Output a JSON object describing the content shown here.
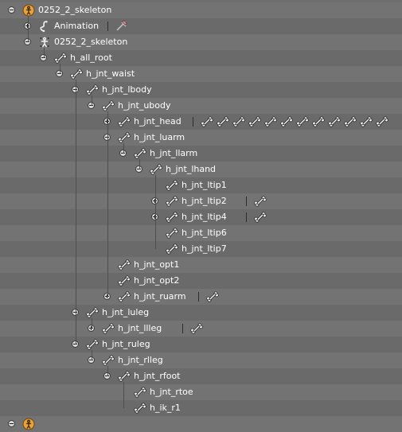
{
  "outliner": {
    "rows": [
      {
        "label": "0252_2_skeleton",
        "icon": "armature-object-icon",
        "expanded": true,
        "children_icons": []
      },
      {
        "label": "Animation",
        "icon": "animation-icon",
        "expanded": false,
        "children_icons": [
          "action-icon"
        ]
      },
      {
        "label": "0252_2_skeleton",
        "icon": "armature-data-icon",
        "expanded": true,
        "children_icons": []
      },
      {
        "label": "h_all_root",
        "icon": "bone-icon",
        "expanded": true,
        "children_icons": []
      },
      {
        "label": "h_jnt_waist",
        "icon": "bone-icon",
        "expanded": true,
        "children_icons": []
      },
      {
        "label": "h_jnt_lbody",
        "icon": "bone-icon",
        "expanded": true,
        "children_icons": []
      },
      {
        "label": "h_jnt_ubody",
        "icon": "bone-icon",
        "expanded": true,
        "children_icons": []
      },
      {
        "label": "h_jnt_head",
        "icon": "bone-icon",
        "expanded": false,
        "children_icons": [
          "bone-icon",
          "bone-icon",
          "bone-icon",
          "bone-icon",
          "bone-icon",
          "bone-icon",
          "bone-icon",
          "bone-icon",
          "bone-icon",
          "bone-icon",
          "bone-icon",
          "bone-icon"
        ]
      },
      {
        "label": "h_jnt_luarm",
        "icon": "bone-icon",
        "expanded": true,
        "children_icons": []
      },
      {
        "label": "h_jnt_llarm",
        "icon": "bone-icon",
        "expanded": true,
        "children_icons": []
      },
      {
        "label": "h_jnt_lhand",
        "icon": "bone-icon",
        "expanded": true,
        "children_icons": []
      },
      {
        "label": "h_jnt_ltip1",
        "icon": "bone-icon",
        "expanded": null,
        "children_icons": []
      },
      {
        "label": "h_jnt_ltip2",
        "icon": "bone-icon",
        "expanded": false,
        "children_icons": [
          "bone-icon"
        ]
      },
      {
        "label": "h_jnt_ltip4",
        "icon": "bone-icon",
        "expanded": false,
        "children_icons": [
          "bone-icon"
        ]
      },
      {
        "label": "h_jnt_ltip6",
        "icon": "bone-icon",
        "expanded": null,
        "children_icons": []
      },
      {
        "label": "h_jnt_ltip7",
        "icon": "bone-icon",
        "expanded": null,
        "children_icons": []
      },
      {
        "label": "h_jnt_opt1",
        "icon": "bone-icon",
        "expanded": null,
        "children_icons": []
      },
      {
        "label": "h_jnt_opt2",
        "icon": "bone-icon",
        "expanded": null,
        "children_icons": []
      },
      {
        "label": "h_jnt_ruarm",
        "icon": "bone-icon",
        "expanded": false,
        "children_icons": [
          "bone-icon"
        ]
      },
      {
        "label": "h_jnt_luleg",
        "icon": "bone-icon",
        "expanded": true,
        "children_icons": []
      },
      {
        "label": "h_jnt_llleg",
        "icon": "bone-icon",
        "expanded": false,
        "children_icons": [
          "bone-icon"
        ]
      },
      {
        "label": "h_jnt_ruleg",
        "icon": "bone-icon",
        "expanded": true,
        "children_icons": []
      },
      {
        "label": "h_jnt_rlleg",
        "icon": "bone-icon",
        "expanded": true,
        "children_icons": []
      },
      {
        "label": "h_jnt_rfoot",
        "icon": "bone-icon",
        "expanded": true,
        "children_icons": []
      },
      {
        "label": "h_jnt_rtoe",
        "icon": "bone-icon",
        "expanded": null,
        "children_icons": []
      },
      {
        "label": "h_ik_r1",
        "icon": "bone-icon",
        "expanded": null,
        "children_icons": []
      },
      {
        "label": "",
        "icon": "armature-object-icon",
        "expanded": true,
        "children_icons": []
      }
    ]
  },
  "colors": {
    "row_light": "#737373",
    "row_dark": "#6a6a6a",
    "tree_line": "#4e4e4e",
    "armature_orange": "#e8a23c"
  }
}
